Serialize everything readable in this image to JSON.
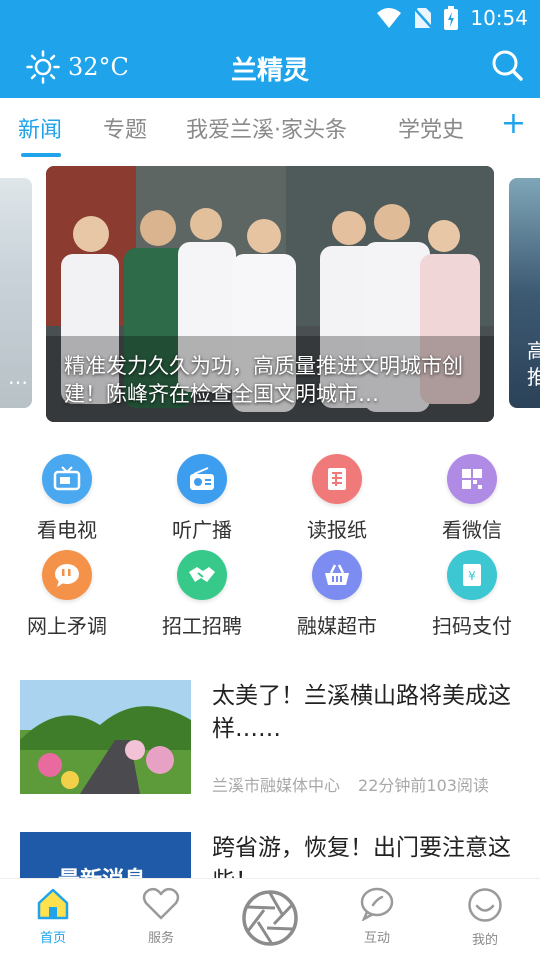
{
  "status": {
    "time": "10:54"
  },
  "header": {
    "weather_temp": "32°C",
    "title": "兰精灵"
  },
  "tabs": [
    {
      "label": "新闻"
    },
    {
      "label": "专题"
    },
    {
      "label": "我爱兰溪·家头条"
    },
    {
      "label": "学党史"
    }
  ],
  "tab_add": "+",
  "carousel": {
    "main_caption": "精准发力久久为功，高质量推进文明城市创建！陈峰齐在检查全国文明城市…",
    "left_caption": "…",
    "right_caption": "高推"
  },
  "services": [
    {
      "label": "看电视",
      "icon": "tv-icon",
      "color": "#4aa8f0"
    },
    {
      "label": "听广播",
      "icon": "radio-icon",
      "color": "#3d9ef0"
    },
    {
      "label": "读报纸",
      "icon": "newspaper-icon",
      "color": "#f07a7a"
    },
    {
      "label": "看微信",
      "icon": "wechat-grid-icon",
      "color": "#b08be6"
    },
    {
      "label": "网上矛调",
      "icon": "chat-bubble-icon",
      "color": "#f5924a"
    },
    {
      "label": "招工招聘",
      "icon": "handshake-icon",
      "color": "#36c98a"
    },
    {
      "label": "融媒超市",
      "icon": "basket-icon",
      "color": "#7c8cf0"
    },
    {
      "label": "扫码支付",
      "icon": "payment-icon",
      "color": "#3cc7d2"
    }
  ],
  "news": [
    {
      "title": "太美了！兰溪横山路将美成这样……",
      "source": "兰溪市融媒体中心",
      "time": "22分钟前",
      "reads": "103阅读"
    },
    {
      "title": "跨省游，恢复！出门要注意这些！",
      "thumb_text": "最新消息"
    }
  ],
  "bottom_nav": [
    {
      "label": "首页",
      "active": true
    },
    {
      "label": "服务"
    },
    {
      "label": ""
    },
    {
      "label": "互动"
    },
    {
      "label": "我的"
    }
  ],
  "colors": {
    "brand": "#1fa4ec",
    "text": "#333333",
    "muted": "#8a8a8a"
  }
}
